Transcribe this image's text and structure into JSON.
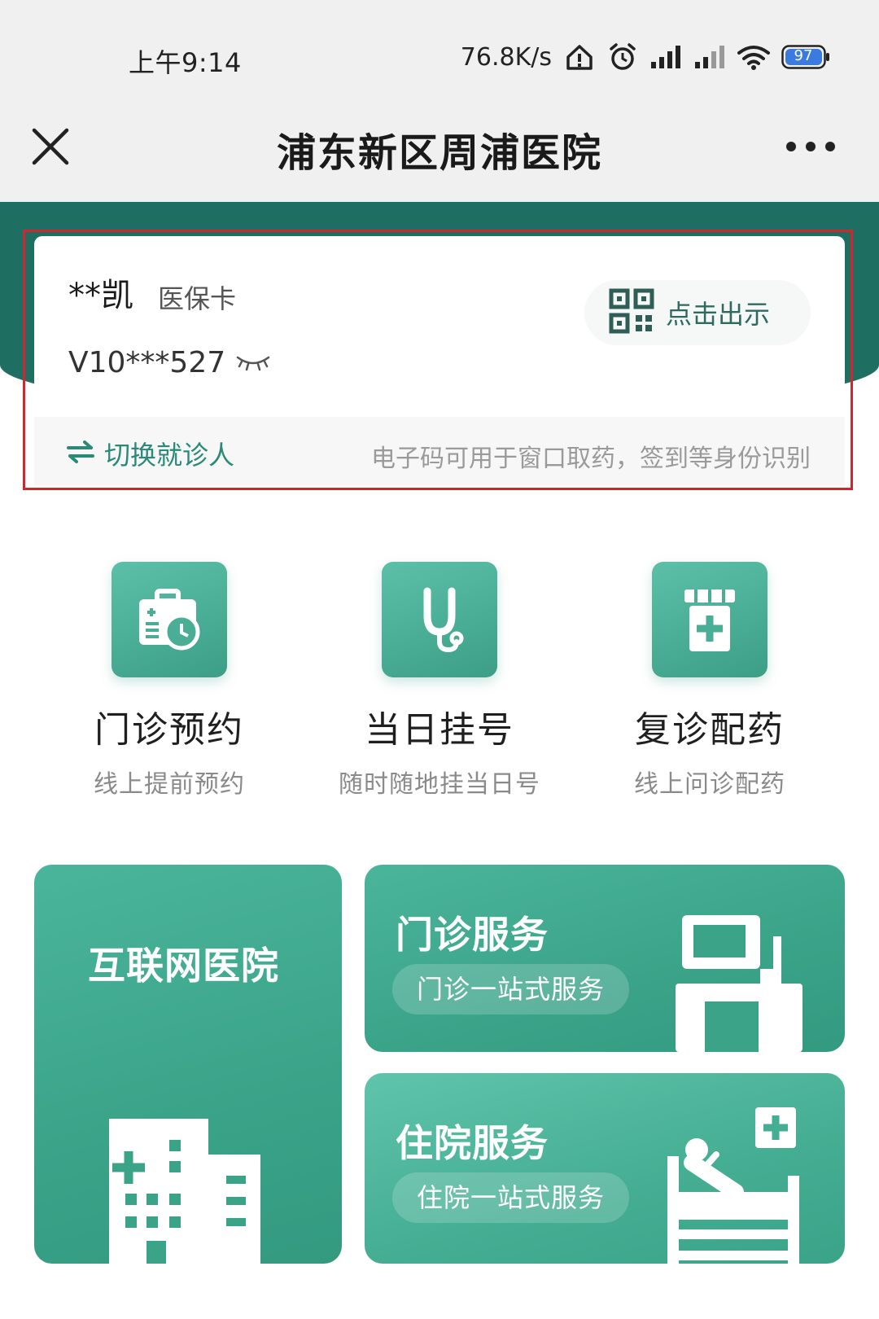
{
  "status_bar": {
    "time": "上午9:14",
    "net_speed": "76.8K/s",
    "battery": "97",
    "icons": [
      "home-alert-icon",
      "alarm-icon",
      "signal-icon",
      "signal-weak-icon",
      "wifi-icon",
      "battery-icon"
    ]
  },
  "nav": {
    "title": "浦东新区周浦医院",
    "icons": [
      "close-icon",
      "more-icon"
    ]
  },
  "card": {
    "name": "**凯",
    "type": "医保卡",
    "number": "V10***527",
    "show_button": "点击出示",
    "switch_label": "切换就诊人",
    "hint": "电子码可用于窗口取药，签到等身份识别",
    "colors": {
      "highlight_border": "#d0262f",
      "accent": "#2a8a78"
    }
  },
  "quick_services": [
    {
      "title": "门诊预约",
      "subtitle": "线上提前预约",
      "icon": "medical-case-clock-icon"
    },
    {
      "title": "当日挂号",
      "subtitle": "随时随地挂当日号",
      "icon": "stethoscope-icon"
    },
    {
      "title": "复诊配药",
      "subtitle": "线上问诊配药",
      "icon": "medicine-bottle-icon"
    }
  ],
  "tiles": {
    "internet_hospital": {
      "title": "互联网医院",
      "icon": "hospital-building-icon"
    },
    "outpatient": {
      "title": "门诊服务",
      "subtitle": "门诊一站式服务",
      "icon": "monitor-equipment-icon"
    },
    "inpatient": {
      "title": "住院服务",
      "subtitle": "住院一站式服务",
      "icon": "hospital-bed-icon"
    }
  },
  "theme": {
    "primary_dark": "#1f6e62",
    "primary": "#3aa388"
  }
}
